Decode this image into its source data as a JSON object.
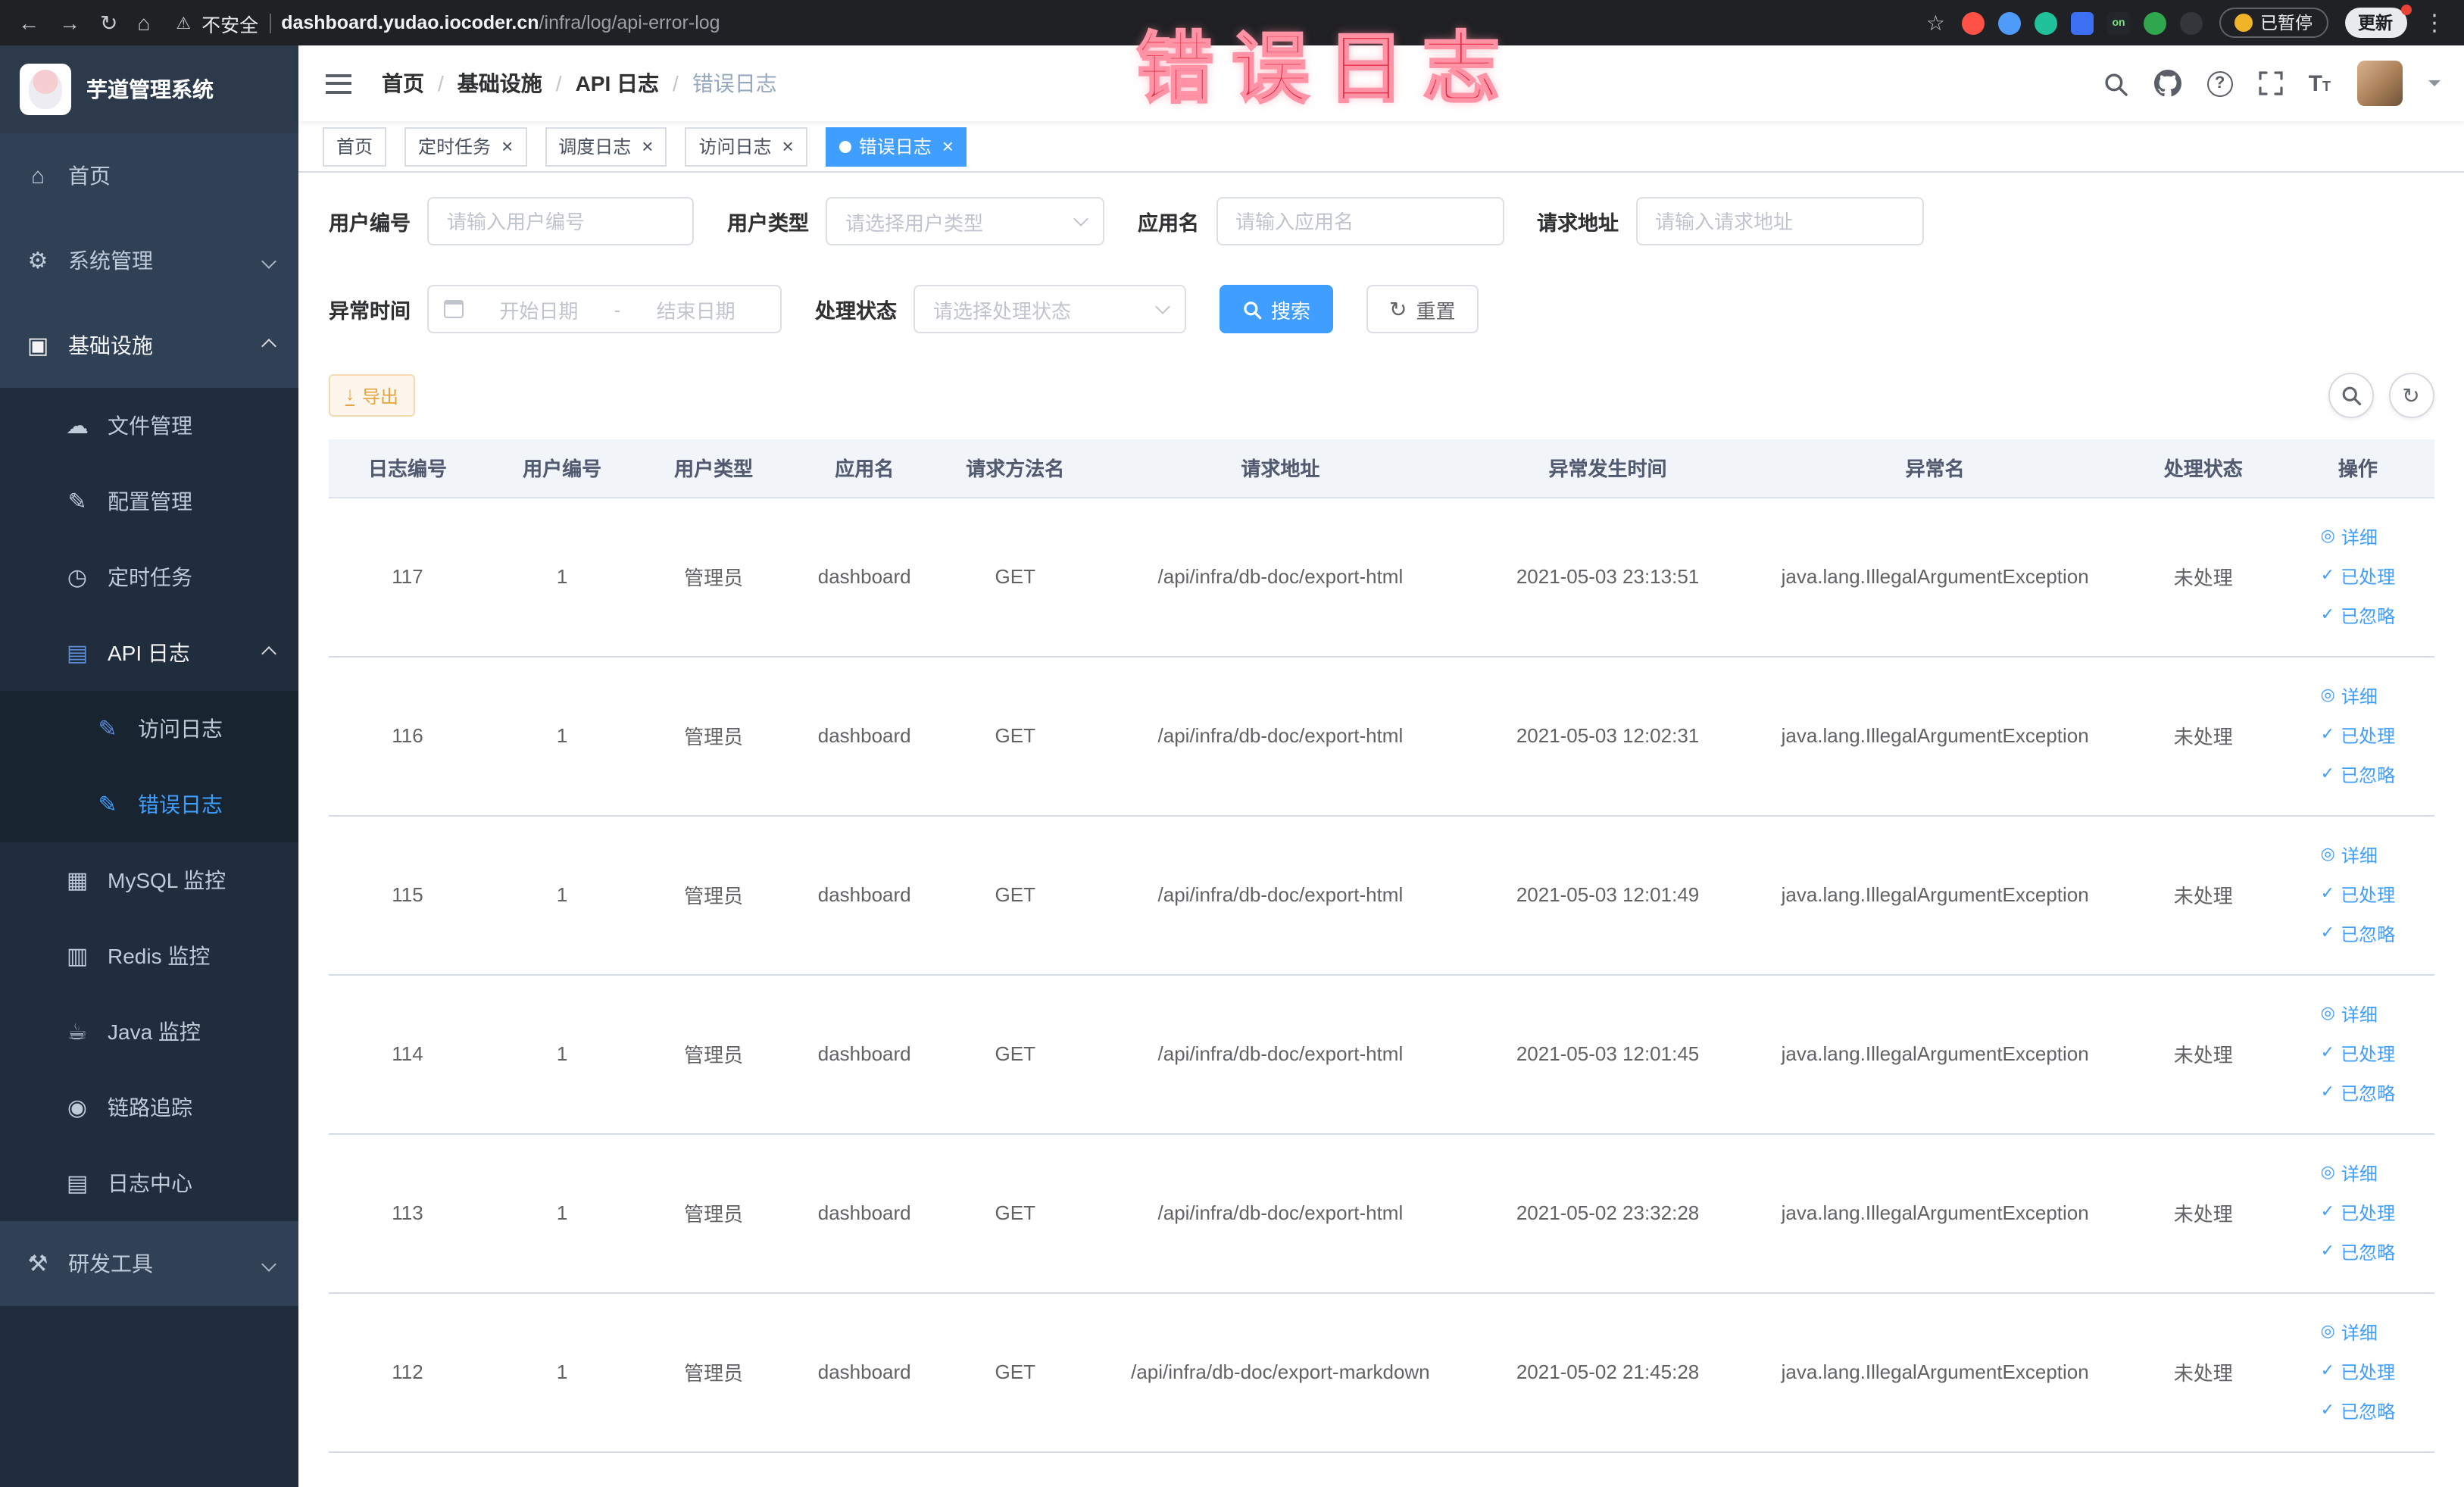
{
  "colors": {
    "accent": "#409EFF",
    "annotation_red": "#e22c44",
    "warning": "#e6a23c",
    "sidebar_bg": "#304156"
  },
  "annotation": {
    "text": "错误日志"
  },
  "browser": {
    "security_label": "不安全",
    "url_host": "dashboard.yudao.iocoder.cn",
    "url_path": "/infra/log/api-error-log",
    "paused_label": "已暂停",
    "update_label": "更新",
    "extensions": [
      {
        "name": "extension-red-icon",
        "color": "#ff5145",
        "shape": "round"
      },
      {
        "name": "extension-drop-icon",
        "color": "#4e9bfa",
        "shape": "round"
      },
      {
        "name": "extension-teal-icon",
        "color": "#21c29b",
        "shape": "round"
      },
      {
        "name": "extension-grid-icon",
        "color": "#3d6ff2",
        "shape": "square"
      },
      {
        "name": "extension-on-icon",
        "color": "#23272b",
        "shape": "square",
        "label": "on"
      },
      {
        "name": "extension-leaf-icon",
        "color": "#30a74f",
        "shape": "round"
      },
      {
        "name": "extension-paw-icon",
        "color": "#33373b",
        "shape": "round"
      }
    ]
  },
  "icons": {
    "home-icon": "⌂",
    "gear-icon": "⚙",
    "infra-icon": "▣",
    "cloud-icon": "☁",
    "edit-icon": "✎",
    "clock-icon": "◷",
    "doc-icon": "▤",
    "grid-icon": "▦",
    "layers-icon": "▥",
    "java-icon": "☕",
    "eye-icon": "◉",
    "tools-icon": "⚒"
  },
  "sidebar": {
    "logo_title": "芋道管理系统",
    "menu": [
      {
        "key": "home",
        "label": "首页",
        "icon": "home-icon",
        "level": 1
      },
      {
        "key": "system",
        "label": "系统管理",
        "icon": "gear-icon",
        "level": 1,
        "expandable": true,
        "expanded": false
      },
      {
        "key": "infra",
        "label": "基础设施",
        "icon": "infra-icon",
        "level": 1,
        "expandable": true,
        "expanded": true
      },
      {
        "key": "file",
        "label": "文件管理",
        "icon": "cloud-icon",
        "level": 2
      },
      {
        "key": "config",
        "label": "配置管理",
        "icon": "edit-icon",
        "level": 2
      },
      {
        "key": "job",
        "label": "定时任务",
        "icon": "clock-icon",
        "level": 2
      },
      {
        "key": "api-log",
        "label": "API 日志",
        "icon": "doc-icon",
        "level": 2,
        "expandable": true,
        "expanded": true,
        "icon_blue": true
      },
      {
        "key": "access-log",
        "label": "访问日志",
        "icon": "edit-icon",
        "level": 3,
        "icon_blue": true
      },
      {
        "key": "error-log",
        "label": "错误日志",
        "icon": "edit-icon",
        "level": 3,
        "active": true,
        "icon_blue": true
      },
      {
        "key": "mysql",
        "label": "MySQL 监控",
        "icon": "grid-icon",
        "level": 2
      },
      {
        "key": "redis",
        "label": "Redis 监控",
        "icon": "layers-icon",
        "level": 2
      },
      {
        "key": "java",
        "label": "Java 监控",
        "icon": "java-icon",
        "level": 2
      },
      {
        "key": "trace",
        "label": "链路追踪",
        "icon": "eye-icon",
        "level": 2
      },
      {
        "key": "log-center",
        "label": "日志中心",
        "icon": "doc-icon",
        "level": 2
      },
      {
        "key": "devtools",
        "label": "研发工具",
        "icon": "tools-icon",
        "level": 1,
        "expandable": true,
        "expanded": false
      }
    ]
  },
  "header": {
    "breadcrumb": [
      "首页",
      "基础设施",
      "API 日志",
      "错误日志"
    ]
  },
  "tabs": [
    {
      "key": "home",
      "label": "首页",
      "closable": false,
      "active": false
    },
    {
      "key": "job",
      "label": "定时任务",
      "closable": true,
      "active": false
    },
    {
      "key": "job-log",
      "label": "调度日志",
      "closable": true,
      "active": false
    },
    {
      "key": "access-log",
      "label": "访问日志",
      "closable": true,
      "active": false
    },
    {
      "key": "error-log",
      "label": "错误日志",
      "closable": true,
      "active": true
    }
  ],
  "filters": {
    "user_id": {
      "label": "用户编号",
      "placeholder": "请输入用户编号"
    },
    "user_type": {
      "label": "用户类型",
      "placeholder": "请选择用户类型"
    },
    "app_name": {
      "label": "应用名",
      "placeholder": "请输入应用名"
    },
    "request_url": {
      "label": "请求地址",
      "placeholder": "请输入请求地址"
    },
    "exception_time": {
      "label": "异常时间",
      "start_placeholder": "开始日期",
      "separator": "-",
      "end_placeholder": "结束日期"
    },
    "process_status": {
      "label": "处理状态",
      "placeholder": "请选择处理状态"
    },
    "search_button": "搜索",
    "reset_button": "重置"
  },
  "toolbar": {
    "export_button": "导出"
  },
  "table": {
    "columns": [
      "日志编号",
      "用户编号",
      "用户类型",
      "应用名",
      "请求方法名",
      "请求地址",
      "异常发生时间",
      "异常名",
      "处理状态",
      "操作"
    ],
    "actions": [
      {
        "key": "detail",
        "label": "详细",
        "glyph": "◎",
        "icon": "eye-icon"
      },
      {
        "key": "processed",
        "label": "已处理",
        "glyph": "✓",
        "icon": "check-icon"
      },
      {
        "key": "ignored",
        "label": "已忽略",
        "glyph": "✓",
        "icon": "check-icon"
      }
    ],
    "rows": [
      {
        "id": "117",
        "user_id": "1",
        "user_type": "管理员",
        "app": "dashboard",
        "method": "GET",
        "url": "/api/infra/db-doc/export-html",
        "time": "2021-05-03 23:13:51",
        "exception": "java.lang.IllegalArgumentException",
        "status": "未处理"
      },
      {
        "id": "116",
        "user_id": "1",
        "user_type": "管理员",
        "app": "dashboard",
        "method": "GET",
        "url": "/api/infra/db-doc/export-html",
        "time": "2021-05-03 12:02:31",
        "exception": "java.lang.IllegalArgumentException",
        "status": "未处理"
      },
      {
        "id": "115",
        "user_id": "1",
        "user_type": "管理员",
        "app": "dashboard",
        "method": "GET",
        "url": "/api/infra/db-doc/export-html",
        "time": "2021-05-03 12:01:49",
        "exception": "java.lang.IllegalArgumentException",
        "status": "未处理"
      },
      {
        "id": "114",
        "user_id": "1",
        "user_type": "管理员",
        "app": "dashboard",
        "method": "GET",
        "url": "/api/infra/db-doc/export-html",
        "time": "2021-05-03 12:01:45",
        "exception": "java.lang.IllegalArgumentException",
        "status": "未处理"
      },
      {
        "id": "113",
        "user_id": "1",
        "user_type": "管理员",
        "app": "dashboard",
        "method": "GET",
        "url": "/api/infra/db-doc/export-html",
        "time": "2021-05-02 23:32:28",
        "exception": "java.lang.IllegalArgumentException",
        "status": "未处理"
      },
      {
        "id": "112",
        "user_id": "1",
        "user_type": "管理员",
        "app": "dashboard",
        "method": "GET",
        "url": "/api/infra/db-doc/export-markdown",
        "time": "2021-05-02 21:45:28",
        "exception": "java.lang.IllegalArgumentException",
        "status": "未处理"
      }
    ]
  }
}
